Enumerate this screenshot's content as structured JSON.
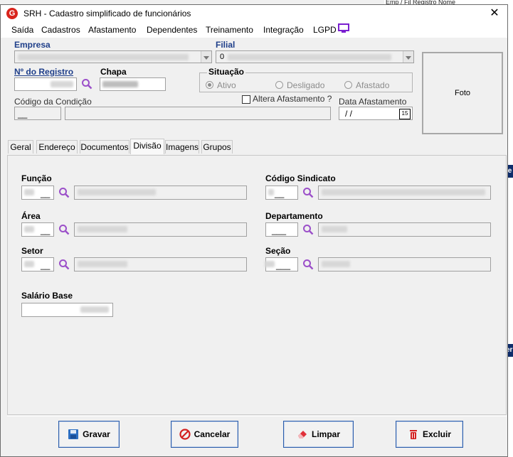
{
  "background": {
    "top_text": "Emp / Fil   Registro  Nome",
    "edge_text_1": "le",
    "edge_text_2": "er"
  },
  "window": {
    "title": "SRH - Cadastro simplificado de funcionários",
    "app_icon_letter": "G",
    "close_glyph": "✕"
  },
  "menu": {
    "items": [
      "Saída",
      "Cadastros",
      "Afastamento",
      "Dependentes",
      "Treinamento",
      "Integração",
      "LGPD"
    ]
  },
  "header": {
    "empresa_label": "Empresa",
    "filial_label": "Filial",
    "filial_value": "0",
    "registro_label": "Nº do Registro",
    "chapa_label": "Chapa",
    "situacao_label": "Situação",
    "situacao_options": [
      "Ativo",
      "Desligado",
      "Afastado"
    ],
    "situacao_selected": "Ativo",
    "codigo_condicao_label": "Código da Condição",
    "codigo_condicao_value": "__",
    "altera_afastamento_label": "Altera Afastamento ?",
    "data_afastamento_label": "Data Afastamento",
    "data_afastamento_value": "/ /",
    "calendar_day": "15",
    "foto_label": "Foto"
  },
  "tabs": {
    "items": [
      "Geral",
      "Endereço",
      "Documentos",
      "Divisão",
      "Imagens",
      "Grupos"
    ],
    "active": "Divisão"
  },
  "divisao": {
    "funcao_label": "Função",
    "funcao_code": "__",
    "area_label": "Área",
    "area_code": "__",
    "setor_label": "Setor",
    "setor_code": "__",
    "salario_label": "Salário Base",
    "codigo_sindicato_label": "Código Sindicato",
    "sindicato_code": "__",
    "departamento_label": "Departamento",
    "departamento_code": "___",
    "secao_label": "Seção",
    "secao_code": "___"
  },
  "buttons": {
    "gravar": "Gravar",
    "cancelar": "Cancelar",
    "limpar": "Limpar",
    "excluir": "Excluir"
  },
  "colors": {
    "accent_label": "#1f3f8a",
    "search_icon": "#9b4fc9",
    "button_border": "#2a5caa",
    "excluir_icon": "#d32020",
    "limpar_icon": "#e0303a",
    "gravar_icon": "#2d6fc2"
  }
}
